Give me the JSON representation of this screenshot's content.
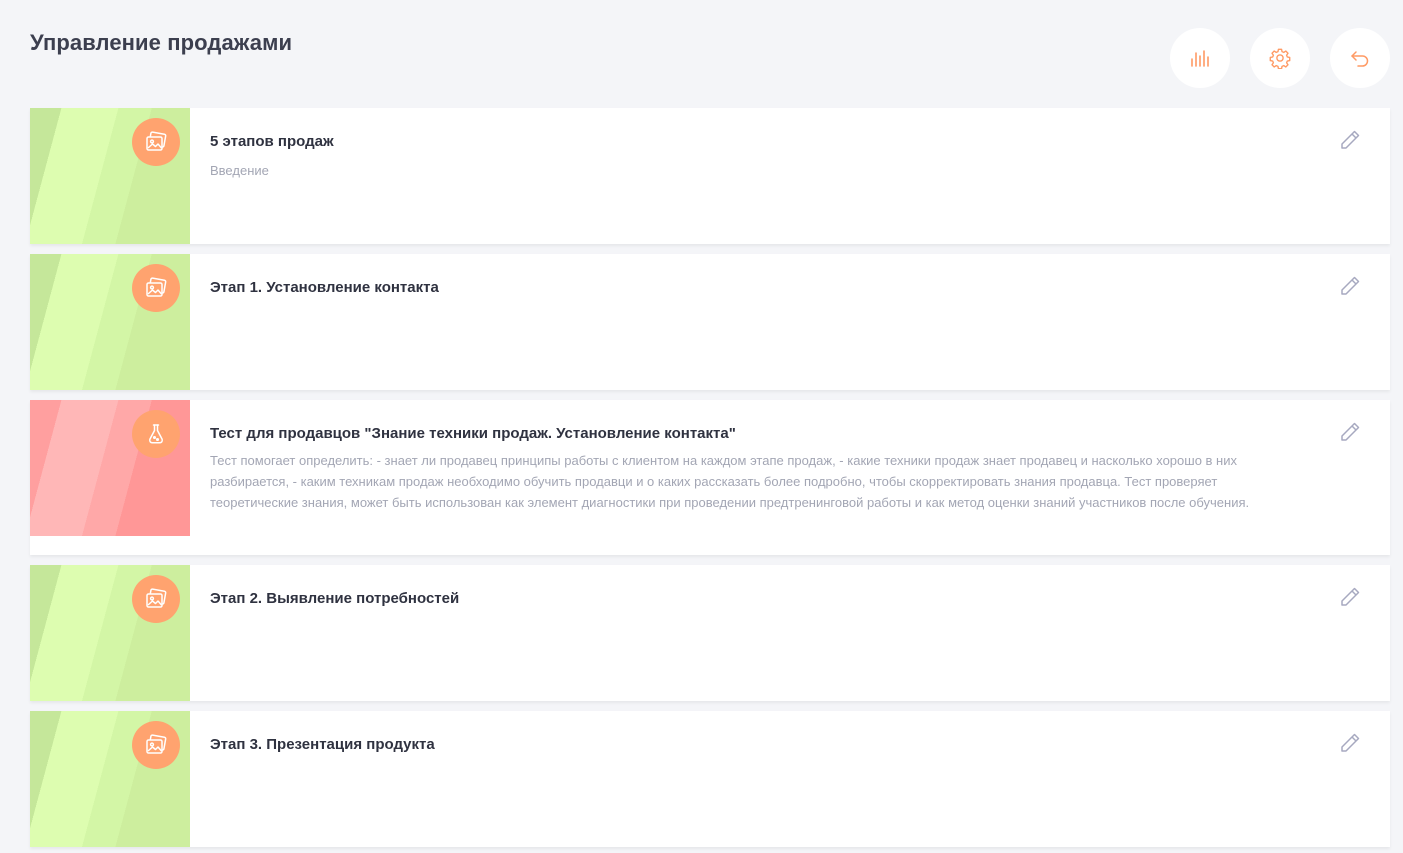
{
  "header": {
    "title": "Управление продажами",
    "tools": [
      {
        "name": "stats",
        "icon": "bar-chart-icon"
      },
      {
        "name": "settings",
        "icon": "gear-icon"
      },
      {
        "name": "back",
        "icon": "undo-arrow-icon"
      }
    ]
  },
  "colors": {
    "accent": "#ffa36f",
    "tool_icon": "#ff9a64",
    "edit_icon": "#a7a9c0"
  },
  "items": [
    {
      "title": "5 этапов продаж",
      "subtitle": "Введение",
      "theme": "green",
      "icon": "image-icon"
    },
    {
      "title": "Этап 1. Установление контакта",
      "subtitle": "",
      "theme": "green",
      "icon": "image-icon"
    },
    {
      "title": "Тест для продавцов \"Знание техники продаж. Установление контакта\"",
      "subtitle": "Тест помогает определить: - знает ли продавец принципы работы с клиентом на каждом этапе продаж, - какие техники продаж знает продавец и насколько хорошо в них разбирается, - каким техникам продаж необходимо обучить продавци и о каких рассказать более подробно, чтобы скорректировать знания продавца. Тест проверяет теоретические знания, может быть использован как элемент диагностики при проведении предтренинговой работы и как метод оценки знаний участников после обучения.",
      "theme": "red",
      "icon": "flask-icon"
    },
    {
      "title": "Этап 2. Выявление потребностей",
      "subtitle": "",
      "theme": "green",
      "icon": "image-icon"
    },
    {
      "title": "Этап 3. Презентация продукта",
      "subtitle": "",
      "theme": "green",
      "icon": "image-icon"
    }
  ]
}
